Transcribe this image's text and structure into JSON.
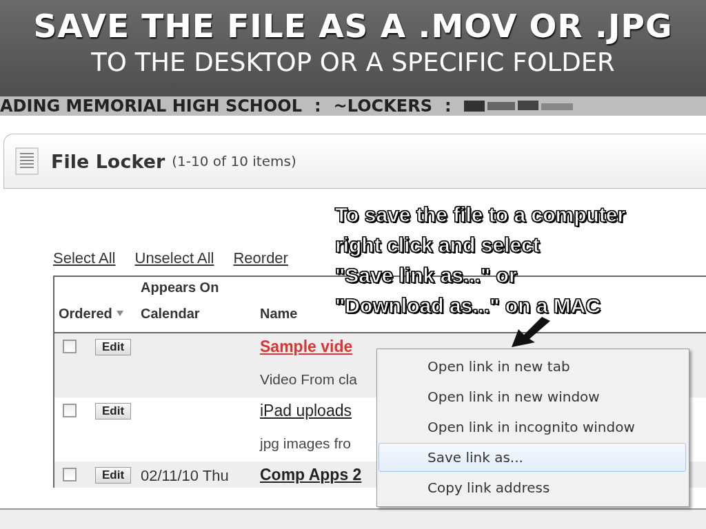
{
  "slide": {
    "title": "SAVE THE FILE AS A .MOV OR .JPG",
    "subtitle": "TO THE DESKTOP OR A SPECIFIC FOLDER"
  },
  "breadcrumb": [
    {
      "kind": "crumb",
      "text": "ADING MEMORIAL HIGH SCHOOL"
    },
    {
      "kind": "separator",
      "text": ":"
    },
    {
      "kind": "crumb",
      "text": "~LOCKERS"
    },
    {
      "kind": "separator",
      "text": ":"
    },
    {
      "kind": "redacted"
    }
  ],
  "panel": {
    "title": "File Locker",
    "count": "(1-10 of 10 items)"
  },
  "actions": [
    "Select All",
    "Unselect All",
    "Reorder"
  ],
  "table": {
    "columns": [
      {
        "label": "Ordered",
        "sorted": true
      },
      {
        "label": "Appears On Calendar",
        "sorted": false
      },
      {
        "label": "Name",
        "sorted": false
      }
    ],
    "rows": [
      {
        "checked": false,
        "edit": "Edit",
        "name": "Sample vide",
        "hovered": true,
        "description": "Video From cla"
      },
      {
        "checked": false,
        "edit": "Edit",
        "name": "iPad uploads",
        "hovered": false,
        "description": "jpg images fro"
      },
      {
        "checked": false,
        "edit": "Edit",
        "date": "02/11/10 Thu",
        "name": "Comp Apps 2",
        "hovered": false
      }
    ]
  },
  "annotation": {
    "lines": [
      "To save the file to a computer",
      "right click and select",
      "\"Save link as...\" or",
      "\"Download as...\" on a MAC"
    ]
  },
  "context_menu": {
    "items": [
      {
        "label": "Open link in new tab",
        "selected": false
      },
      {
        "label": "Open link in new window",
        "selected": false
      },
      {
        "label": "Open link in incognito window",
        "selected": false
      },
      {
        "label": "Save link as...",
        "selected": true
      },
      {
        "label": "Copy link address",
        "selected": false
      }
    ]
  }
}
